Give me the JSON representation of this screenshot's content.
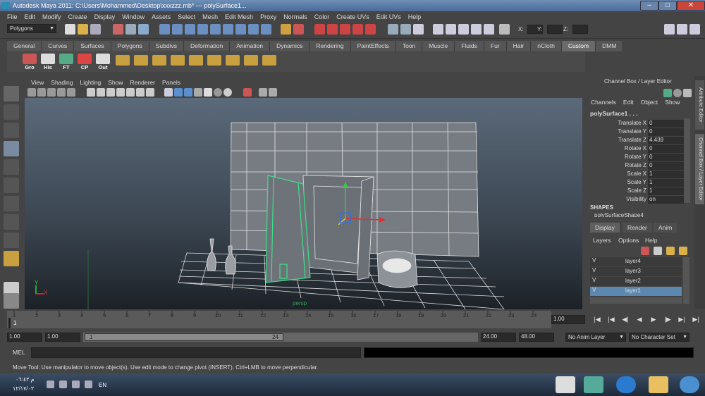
{
  "window": {
    "title": "Autodesk Maya 2011: C:\\Users\\Mohammed\\Desktop\\xxxzzz.mb*   ---   polySurface1..."
  },
  "menubar": [
    "File",
    "Edit",
    "Modify",
    "Create",
    "Display",
    "Window",
    "Assets",
    "Select",
    "Mesh",
    "Edit Mesh",
    "Proxy",
    "Normals",
    "Color",
    "Create UVs",
    "Edit UVs",
    "Help"
  ],
  "statusline": {
    "mode": "Polygons",
    "x_label": "X:",
    "y_label": "Y:",
    "z_label": "Z:"
  },
  "shelf": {
    "tabs": [
      "General",
      "Curves",
      "Surfaces",
      "Polygons",
      "Subdivs",
      "Deformation",
      "Animation",
      "Dynamics",
      "Rendering",
      "PaintEffects",
      "Toon",
      "Muscle",
      "Fluids",
      "Fur",
      "Hair",
      "nCloth",
      "Custom",
      "DMM"
    ],
    "active_tab": "Custom",
    "buttons": [
      "Gro",
      "His",
      "FT",
      "CP",
      "Out"
    ]
  },
  "viewport": {
    "menu": [
      "View",
      "Shading",
      "Lighting",
      "Show",
      "Renderer",
      "Panels"
    ],
    "camera_label": "persp",
    "axis_x": "X",
    "axis_y": "Y"
  },
  "channel_box": {
    "title": "Channel Box / Layer Editor",
    "menu": [
      "Channels",
      "Edit",
      "Object",
      "Show"
    ],
    "object": "polySurface1 . . .",
    "attributes": [
      {
        "name": "Translate X",
        "value": "0"
      },
      {
        "name": "Translate Y",
        "value": "0"
      },
      {
        "name": "Translate Z",
        "value": "4.439"
      },
      {
        "name": "Rotate X",
        "value": "0"
      },
      {
        "name": "Rotate Y",
        "value": "0"
      },
      {
        "name": "Rotate Z",
        "value": "0"
      },
      {
        "name": "Scale X",
        "value": "1"
      },
      {
        "name": "Scale Y",
        "value": "1"
      },
      {
        "name": "Scale Z",
        "value": "1"
      },
      {
        "name": "Visibility",
        "value": "on"
      }
    ],
    "shapes_header": "SHAPES",
    "shape_name": "polySurfaceShape4"
  },
  "side_tabs": [
    "Attribute Editor",
    "Channel Box / Layer Editor"
  ],
  "layer_editor": {
    "tabs": [
      "Display",
      "Render",
      "Anim"
    ],
    "active_tab": "Display",
    "menu": [
      "Layers",
      "Options",
      "Help"
    ],
    "layers": [
      {
        "vis": "V",
        "name": "layer4"
      },
      {
        "vis": "V",
        "name": "layer3"
      },
      {
        "vis": "V",
        "name": "layer2"
      },
      {
        "vis": "V",
        "name": "layer1",
        "selected": true
      }
    ]
  },
  "timeline": {
    "ticks": [
      "1",
      "2",
      "3",
      "4",
      "5",
      "6",
      "7",
      "8",
      "9",
      "10",
      "11",
      "12",
      "13",
      "14",
      "15",
      "16",
      "17",
      "18",
      "19",
      "20",
      "21",
      "22",
      "23",
      "24"
    ],
    "current_frame_value": "1",
    "frame_field": "1.00"
  },
  "range": {
    "start_a": "1.00",
    "start_b": "1.00",
    "slider_start": "1",
    "slider_end": "24",
    "end_a": "24.00",
    "end_b": "48.00",
    "anim_layer": "No Anim Layer",
    "character_set": "No Character Set"
  },
  "cmdline": {
    "label": "MEL"
  },
  "helpline": {
    "text": "Move Tool: Use manipulator to move object(s). Use edit mode to change pivot (INSERT). Ctrl+LMB to move perpendicular."
  },
  "taskbar": {
    "time": "م ٠٦:٤٢",
    "date": "١٢/١٧/٠٢",
    "lang": "EN"
  },
  "colors": {
    "selection_green": "#3ee08a",
    "wire_white": "#e8e8e8",
    "manip_red": "#e03030",
    "manip_green": "#30d040",
    "manip_blue": "#3070e0",
    "selected_layer": "#5c88b0"
  }
}
